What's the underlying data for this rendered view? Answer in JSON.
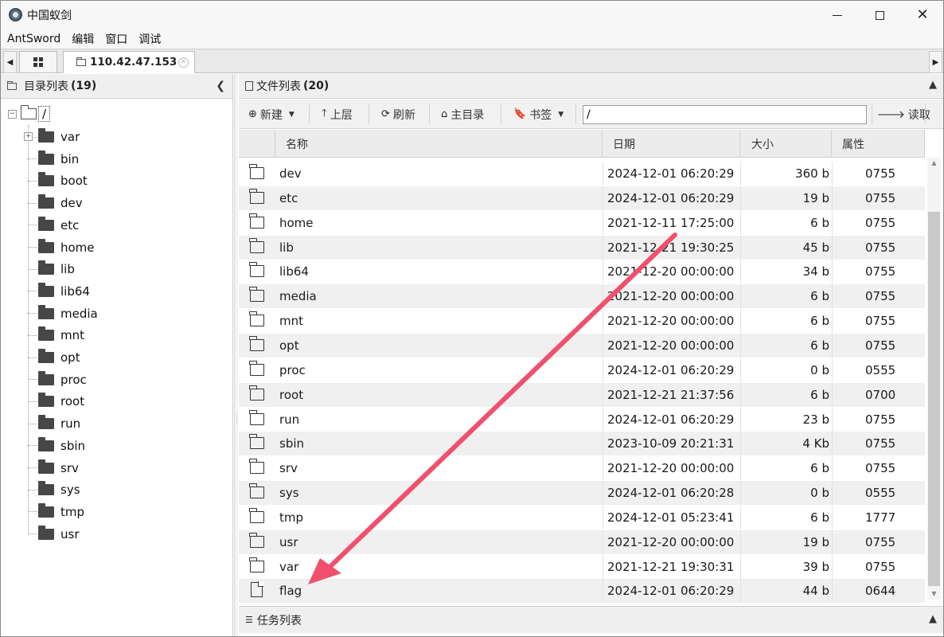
{
  "window": {
    "title": "中国蚁剑",
    "minimize_glyph": "—",
    "maximize_glyph": "☐",
    "close_glyph": "✕"
  },
  "menu": [
    "AntSword",
    "编辑",
    "窗口",
    "调试"
  ],
  "tabs": {
    "host": "110.42.47.153"
  },
  "left_panel": {
    "title": "目录列表",
    "count": "(19)"
  },
  "tree": {
    "root": "/",
    "items": [
      "var",
      "bin",
      "boot",
      "dev",
      "etc",
      "home",
      "lib",
      "lib64",
      "media",
      "mnt",
      "opt",
      "proc",
      "root",
      "run",
      "sbin",
      "srv",
      "sys",
      "tmp",
      "usr"
    ]
  },
  "right_panel": {
    "title": "文件列表",
    "count": "(20)"
  },
  "toolbar": {
    "new": "新建",
    "up": "上层",
    "refresh": "刷新",
    "home": "主目录",
    "bookmark": "书签",
    "path": "/",
    "read": "读取"
  },
  "columns": {
    "name": "名称",
    "date": "日期",
    "size": "大小",
    "attr": "属性"
  },
  "files": [
    {
      "name": "dev",
      "date": "2024-12-01 06:20:29",
      "size": "360 b",
      "attr": "0755",
      "type": "folder"
    },
    {
      "name": "etc",
      "date": "2024-12-01 06:20:29",
      "size": "19 b",
      "attr": "0755",
      "type": "folder"
    },
    {
      "name": "home",
      "date": "2021-12-11 17:25:00",
      "size": "6 b",
      "attr": "0755",
      "type": "folder"
    },
    {
      "name": "lib",
      "date": "2021-12-21 19:30:25",
      "size": "45 b",
      "attr": "0755",
      "type": "folder"
    },
    {
      "name": "lib64",
      "date": "2021-12-20 00:00:00",
      "size": "34 b",
      "attr": "0755",
      "type": "folder"
    },
    {
      "name": "media",
      "date": "2021-12-20 00:00:00",
      "size": "6 b",
      "attr": "0755",
      "type": "folder"
    },
    {
      "name": "mnt",
      "date": "2021-12-20 00:00:00",
      "size": "6 b",
      "attr": "0755",
      "type": "folder"
    },
    {
      "name": "opt",
      "date": "2021-12-20 00:00:00",
      "size": "6 b",
      "attr": "0755",
      "type": "folder"
    },
    {
      "name": "proc",
      "date": "2024-12-01 06:20:29",
      "size": "0 b",
      "attr": "0555",
      "type": "folder"
    },
    {
      "name": "root",
      "date": "2021-12-21 21:37:56",
      "size": "6 b",
      "attr": "0700",
      "type": "folder"
    },
    {
      "name": "run",
      "date": "2024-12-01 06:20:29",
      "size": "23 b",
      "attr": "0755",
      "type": "folder"
    },
    {
      "name": "sbin",
      "date": "2023-10-09 20:21:31",
      "size": "4 Kb",
      "attr": "0755",
      "type": "folder"
    },
    {
      "name": "srv",
      "date": "2021-12-20 00:00:00",
      "size": "6 b",
      "attr": "0755",
      "type": "folder"
    },
    {
      "name": "sys",
      "date": "2024-12-01 06:20:28",
      "size": "0 b",
      "attr": "0555",
      "type": "folder"
    },
    {
      "name": "tmp",
      "date": "2024-12-01 05:23:41",
      "size": "6 b",
      "attr": "1777",
      "type": "folder"
    },
    {
      "name": "usr",
      "date": "2021-12-20 00:00:00",
      "size": "19 b",
      "attr": "0755",
      "type": "folder"
    },
    {
      "name": "var",
      "date": "2021-12-21 19:30:31",
      "size": "39 b",
      "attr": "0755",
      "type": "folder"
    },
    {
      "name": "flag",
      "date": "2024-12-01 06:20:29",
      "size": "44 b",
      "attr": "0644",
      "type": "file"
    }
  ],
  "tasks": {
    "title": "任务列表"
  },
  "annotation": {
    "arrow_color": "#f0506e"
  }
}
